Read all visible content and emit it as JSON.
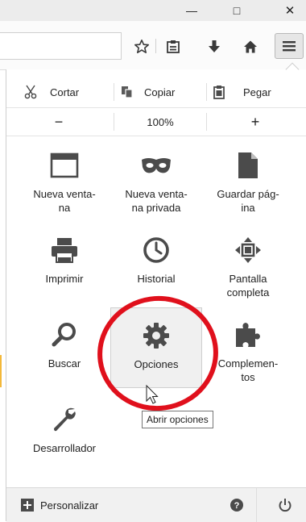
{
  "window": {
    "minimize": "—",
    "maximize": "□",
    "close": "✕"
  },
  "toolbar": {
    "icons": [
      "star-icon",
      "reading-list-icon",
      "download-icon",
      "home-icon"
    ],
    "menu_icon": "hamburger-menu-icon"
  },
  "edit": {
    "cut": "Cortar",
    "copy": "Copiar",
    "paste": "Pegar"
  },
  "zoom": {
    "minus": "−",
    "level": "100%",
    "plus": "+"
  },
  "items": [
    {
      "label": "Nueva venta-\nna",
      "icon": "new-window-icon"
    },
    {
      "label": "Nueva venta-\nna privada",
      "icon": "private-mask-icon"
    },
    {
      "label": "Guardar pág-\nina",
      "icon": "save-page-icon"
    },
    {
      "label": "Imprimir",
      "icon": "print-icon"
    },
    {
      "label": "Historial",
      "icon": "history-clock-icon"
    },
    {
      "label": "Pantalla\ncompleta",
      "icon": "fullscreen-icon"
    },
    {
      "label": "Buscar",
      "icon": "search-icon"
    },
    {
      "label": "Opciones",
      "icon": "gear-icon"
    },
    {
      "label": "Complemen-\ntos",
      "icon": "puzzle-icon"
    },
    {
      "label": "Desarrollador",
      "icon": "wrench-icon"
    }
  ],
  "footer": {
    "customize": "Personalizar",
    "help_icon": "help-icon",
    "quit_icon": "power-icon"
  },
  "tooltip": "Abrir opciones",
  "colors": {
    "annotation_circle": "#e0101c",
    "accent_dark": "#4b4b4b"
  }
}
